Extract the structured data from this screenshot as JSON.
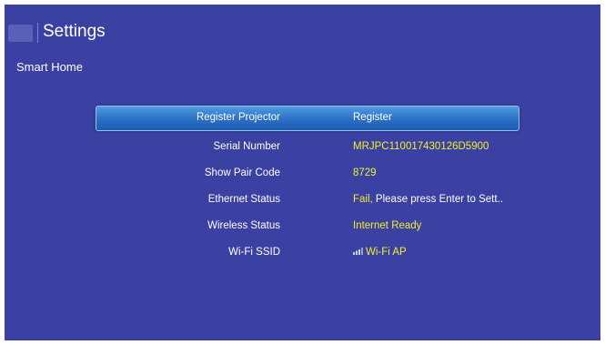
{
  "header": {
    "title": "Settings",
    "subtitle": "Smart Home"
  },
  "rows": [
    {
      "label": "Register Projector",
      "value": "Register"
    },
    {
      "label": "Serial Number",
      "value": "MRJPC110017430126D5900"
    },
    {
      "label": "Show Pair Code",
      "value": "8729"
    },
    {
      "label": "Ethernet Status",
      "value_status": "Fail,",
      "value_message": " Please press Enter to Sett.."
    },
    {
      "label": "Wireless Status",
      "value": "Internet Ready"
    },
    {
      "label": "Wi-Fi SSID",
      "value": "Wi-Fi AP",
      "icon": "wifi-signal-icon"
    }
  ],
  "colors": {
    "background": "#3a41a3",
    "value_text": "#f3ee2b",
    "highlight": "#2a6fc5"
  }
}
